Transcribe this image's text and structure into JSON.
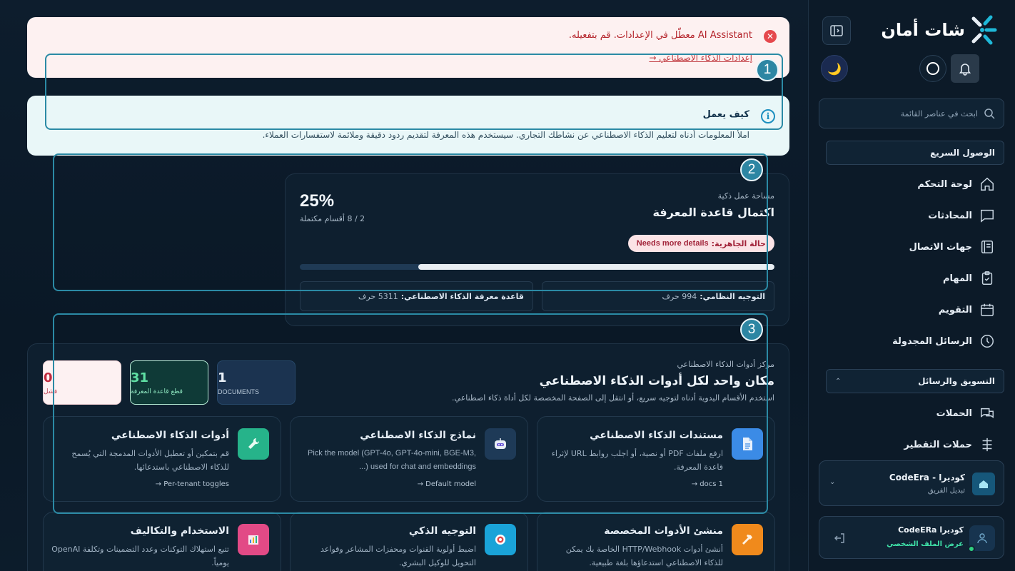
{
  "alerts": {
    "error_message": "AI Assistant معطّل في الإعدادات. قم بتفعيله.",
    "error_link": "إعدادات الذكاء الاصطناعي →",
    "info_title": "كيف يعمل",
    "info_body": "املأ المعلومات أدناه لتعليم الذكاء الاصطناعي عن نشاطك التجاري. سيستخدم هذه المعرفة لتقديم ردود دقيقة وملائمة لاستفسارات العملاء."
  },
  "workspace": {
    "eyebrow": "مساحة عمل ذكية",
    "title": "اكتمال قاعدة المعرفة",
    "percent": "25%",
    "sections_done": "2 / 8 أقسام مكتملة",
    "readiness_label": "حالة الجاهزية:",
    "readiness_value": "Needs more details",
    "progress_fraction": 0.25,
    "system_prompt_label": "التوجيه النظامي:",
    "system_prompt_value": "994 حرف",
    "kb_label": "قاعدة معرفة الذكاء الاصطناعي:",
    "kb_value": "5311 حرف"
  },
  "hub": {
    "eyebrow": "مركز أدوات الذكاء الاصطناعي",
    "title": "مكان واحد لكل أدوات الذكاء الاصطناعي",
    "subtitle": "استخدم الأقسام اليدوية أدناه لتوجيه سريع، أو انتقل إلى الصفحة المخصصة لكل أداة ذكاء اصطناعي.",
    "stats": [
      {
        "value": "1",
        "label": "DOCUMENTS"
      },
      {
        "value": "31",
        "label": "قطع قاعدة المعرفة"
      },
      {
        "value": "0",
        "label": "فشل"
      }
    ],
    "tools": [
      {
        "icon": "document-icon",
        "color": "#3b8be6",
        "title": "مستندات الذكاء الاصطناعي",
        "desc": "ارفع ملفات PDF أو نصية، أو اجلب روابط URL لإثراء قاعدة المعرفة.",
        "link": "docs 1 →"
      },
      {
        "icon": "robot-icon",
        "color": "#1e3a57",
        "title": "نماذج الذكاء الاصطناعي",
        "desc": "Pick the model (GPT-4o, GPT-4o-mini, BGE-M3, ...) used for chat and embeddings",
        "link": "Default model →"
      },
      {
        "icon": "wrench-icon",
        "color": "#26b38a",
        "title": "أدوات الذكاء الاصطناعي",
        "desc": "قم بتمكين أو تعطيل الأدوات المدمجة التي يُسمح للذكاء الاصطناعي باستدعائها.",
        "link": "Per-tenant toggles →"
      },
      {
        "icon": "hammer-icon",
        "color": "#f08a1c",
        "title": "منشئ الأدوات المخصصة",
        "desc": "أنشئ أدوات HTTP/Webhook الخاصة بك يمكن للذكاء الاصطناعي استدعاؤها بلغة طبيعية.",
        "link": ""
      },
      {
        "icon": "target-icon",
        "color": "#1aa3d8",
        "title": "التوجيه الذكي",
        "desc": "اضبط أولوية القنوات ومحفزات المشاعر وقواعد التحويل للوكيل البشري.",
        "link": ""
      },
      {
        "icon": "chart-icon",
        "color": "#e24a86",
        "title": "الاستخدام والتكاليف",
        "desc": "تتبع استهلاك التوكنات وعدد التضمينات وتكلفة OpenAI يومياً.",
        "link": ""
      }
    ]
  },
  "sidebar": {
    "brand": "شات أمان",
    "search_placeholder": "ابحث في عناصر القائمة",
    "quick_access": "الوصول السريع",
    "nav": [
      {
        "label": "لوحة التحكم",
        "icon": "home-icon"
      },
      {
        "label": "المحادثات",
        "icon": "chat-icon"
      },
      {
        "label": "جهات الاتصال",
        "icon": "contacts-icon"
      },
      {
        "label": "المهام",
        "icon": "clipboard-icon"
      },
      {
        "label": "التقويم",
        "icon": "calendar-icon"
      },
      {
        "label": "الرسائل المجدولة",
        "icon": "clock-icon"
      }
    ],
    "marketing_header": "التسويق والرسائل",
    "marketing_nav": [
      {
        "label": "الحملات",
        "icon": "campaign-icon"
      },
      {
        "label": "حملات التقطير",
        "icon": "drip-icon"
      }
    ],
    "team_name": "كوديرا - CodeEra",
    "team_sub": "تبديل الفريق",
    "profile_name": "كوديرا CodeERa",
    "profile_sub": "عرض الملف الشخصي"
  }
}
